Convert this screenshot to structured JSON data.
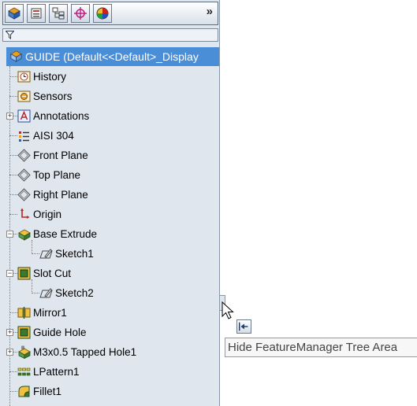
{
  "tabs": [
    {
      "name": "featuremanager-tab-icon"
    },
    {
      "name": "propertymanager-tab-icon"
    },
    {
      "name": "configurationmanager-tab-icon"
    },
    {
      "name": "dimxpertmanager-tab-icon"
    },
    {
      "name": "displaymanager-tab-icon"
    }
  ],
  "tabbar": {
    "more_label": "»"
  },
  "tree": {
    "root_label": "GUIDE  (Default<<Default>_Display",
    "items": [
      {
        "label": "History",
        "icon": "history-icon"
      },
      {
        "label": "Sensors",
        "icon": "sensors-icon"
      },
      {
        "label": "Annotations",
        "icon": "annotations-icon"
      },
      {
        "label": "AISI 304",
        "icon": "material-icon"
      },
      {
        "label": "Front Plane",
        "icon": "plane-icon"
      },
      {
        "label": "Top Plane",
        "icon": "plane-icon"
      },
      {
        "label": "Right Plane",
        "icon": "plane-icon"
      },
      {
        "label": "Origin",
        "icon": "origin-icon"
      },
      {
        "label": "Base Extrude",
        "icon": "extrude-icon"
      },
      {
        "label": "Sketch1",
        "icon": "sketch-icon"
      },
      {
        "label": "Slot Cut",
        "icon": "cut-icon"
      },
      {
        "label": "Sketch2",
        "icon": "sketch-icon"
      },
      {
        "label": "Mirror1",
        "icon": "mirror-icon"
      },
      {
        "label": "Guide Hole",
        "icon": "cut-icon"
      },
      {
        "label": "M3x0.5 Tapped Hole1",
        "icon": "hole-wizard-icon"
      },
      {
        "label": "LPattern1",
        "icon": "linear-pattern-icon"
      },
      {
        "label": "Fillet1",
        "icon": "fillet-icon"
      }
    ]
  },
  "tooltip": {
    "text": "Hide FeatureManager Tree Area"
  }
}
